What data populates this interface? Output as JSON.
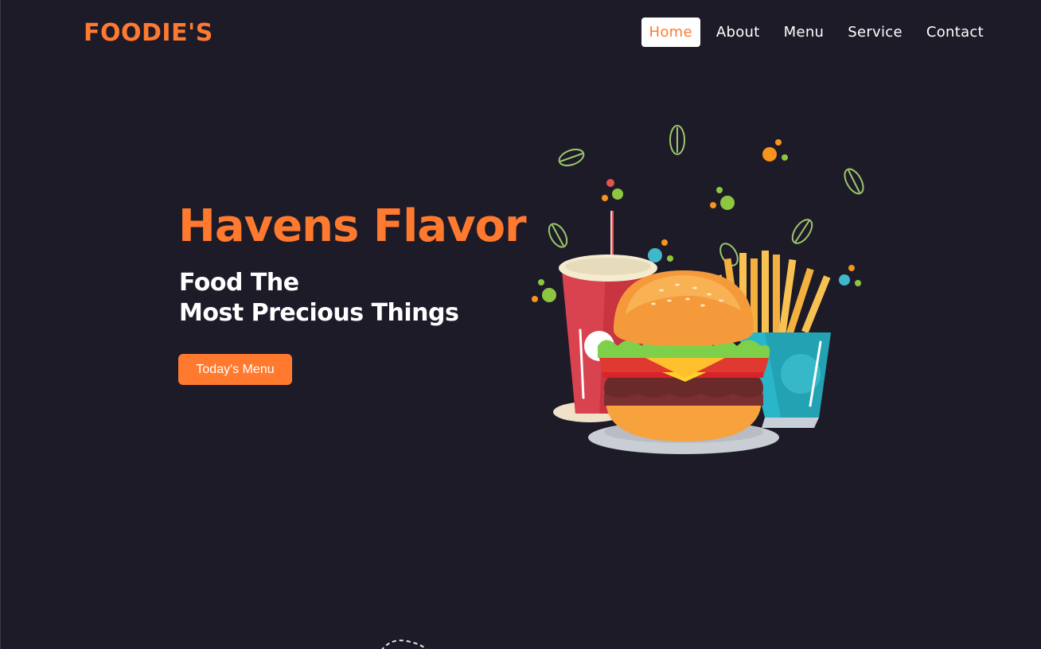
{
  "brand": {
    "logo_text": "FOODIE'S",
    "accent_color": "#ff7a2f",
    "background_color": "#1e1b29"
  },
  "nav": {
    "items": [
      {
        "label": "Home",
        "active": true
      },
      {
        "label": "About",
        "active": false
      },
      {
        "label": "Menu",
        "active": false
      },
      {
        "label": "Service",
        "active": false
      },
      {
        "label": "Contact",
        "active": false
      }
    ]
  },
  "hero": {
    "title": "Havens Flavor",
    "subtitle_line1": "Food The",
    "subtitle_line2": "Most Precious Things",
    "cta_label": "Today's Menu",
    "illustration": "burger-fries-drink-illustration"
  }
}
